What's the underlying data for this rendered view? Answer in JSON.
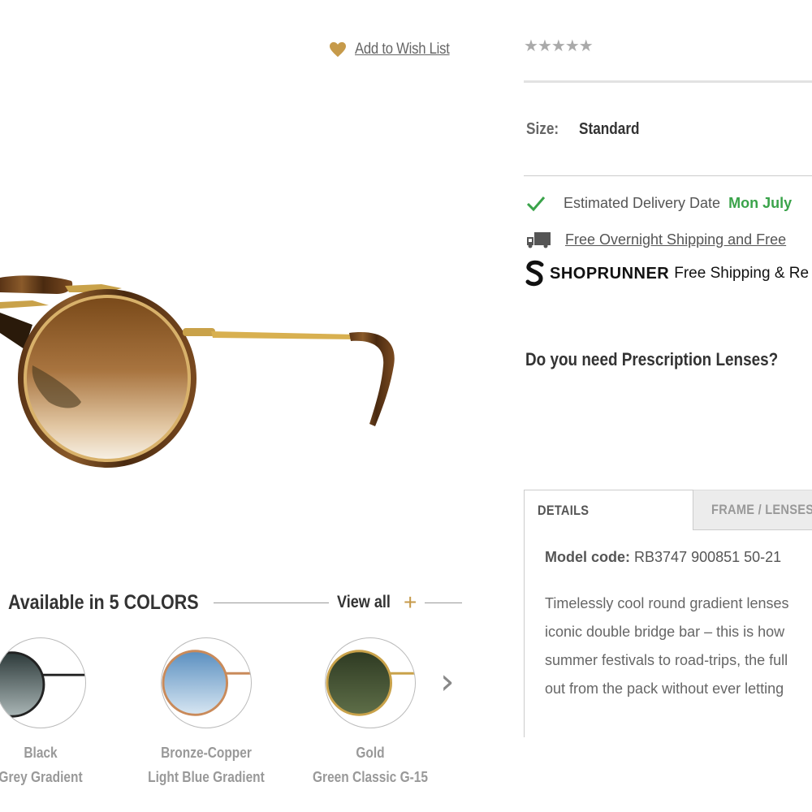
{
  "wishlist": {
    "label": "Add to Wish List",
    "icon": "heart-icon",
    "color": "#c69a4a"
  },
  "rating": {
    "stars": 5,
    "filled": 0
  },
  "size": {
    "label": "Size:",
    "value": "Standard"
  },
  "delivery": {
    "label": "Estimated Delivery Date",
    "date": "Mon July"
  },
  "shipping": {
    "label": "Free Overnight Shipping and Free"
  },
  "shoprunner": {
    "brand": "SHOPRUNNER",
    "text": "Free Shipping & Re"
  },
  "prescription": {
    "question": "Do you need Prescription Lenses?"
  },
  "tabs": [
    {
      "label": "DETAILS",
      "active": true
    },
    {
      "label": "FRAME / LENSES",
      "active": false
    }
  ],
  "details": {
    "model_label": "Model code:",
    "model_value": "RB3747 900851 50-21",
    "description_lines": [
      "Timelessly cool round gradient lenses",
      "iconic double bridge bar – this is how",
      "summer festivals to road-trips, the full",
      "out from the pack without ever letting"
    ]
  },
  "colors": {
    "title": "Available in 5 COLORS",
    "view_all": "View all",
    "view_all_icon": "plus-icon",
    "next_icon": "chevron-right-icon",
    "items": [
      {
        "frame": "Black",
        "lens": "Grey Gradient"
      },
      {
        "frame": "Bronze-Copper",
        "lens": "Light Blue Gradient"
      },
      {
        "frame": "Gold",
        "lens": "Green Classic G-15"
      }
    ]
  },
  "colors_theme": {
    "accent": "#c69a4a",
    "green": "#3aa34a"
  }
}
